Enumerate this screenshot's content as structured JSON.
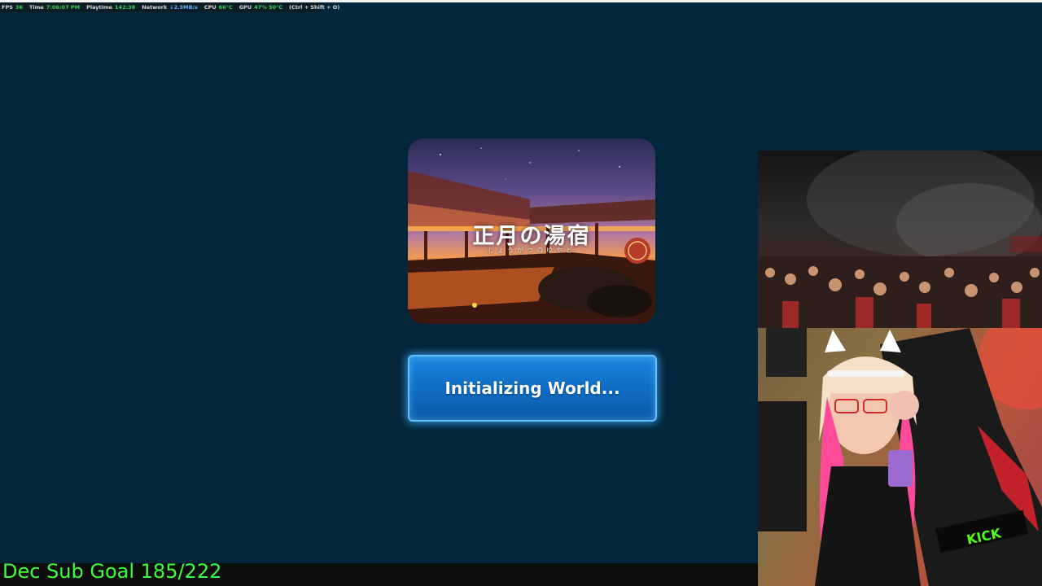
{
  "perf_overlay": {
    "fps_label": "FPS",
    "fps_value": "36",
    "time_label": "Time",
    "time_value": "7:06:07 PM",
    "playtime_label": "Playtime",
    "playtime_value": "142:38",
    "network_label": "Network",
    "network_value": "↓2.5MB/s",
    "cpu_label": "CPU",
    "cpu_value": "66°C",
    "gpu_label": "GPU",
    "gpu_value": "47%  50°C",
    "shortcut_hint": "(Ctrl + Shift + O)"
  },
  "world_card": {
    "title": "正月の湯宿",
    "subtitle": "しょうがつのゆやど",
    "thumbnail_icon": "world-thumbnail-image"
  },
  "loading": {
    "status": "Initializing World..."
  },
  "stream": {
    "concert_video_icon": "concert-crowd-video",
    "webcam_icon": "streamer-webcam-video",
    "kick_logo_text": "KICK"
  },
  "sub_goal": {
    "text": "Dec Sub Goal 185/222"
  },
  "colors": {
    "background": "#03263a",
    "button_blue": "#0f6fc6",
    "button_glow": "#5fc0ff",
    "goal_green": "#3cff3c",
    "perf_green": "#39d353"
  }
}
